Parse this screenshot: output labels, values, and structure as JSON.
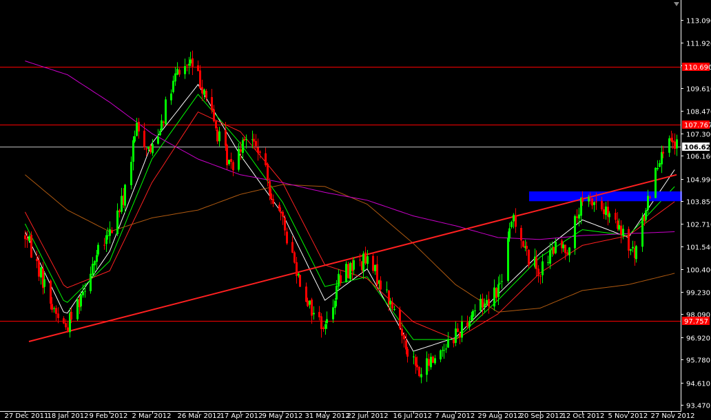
{
  "chart_data": {
    "type": "candlestick",
    "y_ticks": [
      "113.090",
      "111.920",
      "110.780",
      "109.610",
      "108.470",
      "107.300",
      "106.160",
      "104.990",
      "103.850",
      "102.710",
      "101.540",
      "100.400",
      "99.230",
      "98.090",
      "96.920",
      "95.780",
      "94.610",
      "93.470"
    ],
    "x_ticks": [
      "27 Dec 2011",
      "18 Jan 2012",
      "9 Feb 2012",
      "2 Mar 2012",
      "26 Mar 2012",
      "17 Apr 2012",
      "9 May 2012",
      "31 May 2012",
      "22 Jun 2012",
      "16 Jul 2012",
      "7 Aug 2012",
      "29 Aug 2012",
      "20 Sep 2012",
      "12 Oct 2012",
      "5 Nov 2012",
      "27 Nov 2012"
    ],
    "ylim": [
      93.2,
      113.8
    ],
    "horizontal_levels": [
      {
        "value": 110.69,
        "label": "110.690",
        "color": "#ff0000"
      },
      {
        "value": 107.767,
        "label": "107.767",
        "color": "#ff0000"
      },
      {
        "value": 97.757,
        "label": "97.757",
        "color": "#ff0000"
      }
    ],
    "current_price": {
      "value": 106.624,
      "label": "106.624",
      "color": "#c0c0c0"
    },
    "trendline": {
      "from": {
        "x": "29 Dec 2011",
        "y": 96.7
      },
      "to": {
        "x": "30 Nov 2012",
        "y": 105.2
      },
      "color": "#ff2020"
    },
    "zone": {
      "from": "20 Sep 2012",
      "to": "30 Nov 2012",
      "y_low": 103.85,
      "y_high": 104.35,
      "color": "#0000ff"
    },
    "anchors": [
      [
        "27 Dec 2011",
        102.1
      ],
      [
        "3 Jan 2012",
        100.4
      ],
      [
        "10 Jan 2012",
        98.5
      ],
      [
        "17 Jan 2012",
        97.4
      ],
      [
        "24 Jan 2012",
        98.9
      ],
      [
        "31 Jan 2012",
        100.7
      ],
      [
        "9 Feb 2012",
        102.2
      ],
      [
        "16 Feb 2012",
        104.0
      ],
      [
        "23 Feb 2012",
        107.6
      ],
      [
        "1 Mar 2012",
        106.4
      ],
      [
        "8 Mar 2012",
        108.3
      ],
      [
        "15 Mar 2012",
        110.4
      ],
      [
        "22 Mar 2012",
        110.9
      ],
      [
        "29 Mar 2012",
        109.6
      ],
      [
        "5 Apr 2012",
        107.2
      ],
      [
        "12 Apr 2012",
        105.6
      ],
      [
        "19 Apr 2012",
        107.3
      ],
      [
        "26 Apr 2012",
        106.5
      ],
      [
        "3 May 2012",
        104.3
      ],
      [
        "10 May 2012",
        102.4
      ],
      [
        "17 May 2012",
        100.1
      ],
      [
        "24 May 2012",
        98.3
      ],
      [
        "31 May 2012",
        97.4
      ],
      [
        "7 Jun 2012",
        99.8
      ],
      [
        "14 Jun 2012",
        100.6
      ],
      [
        "21 Jun 2012",
        100.8
      ],
      [
        "28 Jun 2012",
        99.9
      ],
      [
        "5 Jul 2012",
        98.4
      ],
      [
        "12 Jul 2012",
        96.6
      ],
      [
        "19 Jul 2012",
        95.0
      ],
      [
        "26 Jul 2012",
        95.8
      ],
      [
        "2 Aug 2012",
        96.6
      ],
      [
        "9 Aug 2012",
        97.3
      ],
      [
        "16 Aug 2012",
        98.3
      ],
      [
        "23 Aug 2012",
        98.8
      ],
      [
        "30 Aug 2012",
        99.6
      ],
      [
        "6 Sep 2012",
        103.2
      ],
      [
        "13 Sep 2012",
        101.1
      ],
      [
        "20 Sep 2012",
        100.3
      ],
      [
        "27 Sep 2012",
        101.4
      ],
      [
        "4 Oct 2012",
        101.5
      ],
      [
        "11 Oct 2012",
        103.6
      ],
      [
        "18 Oct 2012",
        103.9
      ],
      [
        "25 Oct 2012",
        103.1
      ],
      [
        "1 Nov 2012",
        102.2
      ],
      [
        "8 Nov 2012",
        101.0
      ],
      [
        "15 Nov 2012",
        104.0
      ],
      [
        "22 Nov 2012",
        106.6
      ],
      [
        "30 Nov 2012",
        106.62
      ]
    ],
    "overlays": [
      {
        "color": "#ffffff",
        "points": [
          [
            "27 Dec 2011",
            102.3
          ],
          [
            "17 Jan 2012",
            98.0
          ],
          [
            "9 Feb 2012",
            101.3
          ],
          [
            "2 Mar 2012",
            106.8
          ],
          [
            "26 Mar 2012",
            109.8
          ],
          [
            "17 Apr 2012",
            106.2
          ],
          [
            "9 May 2012",
            103.2
          ],
          [
            "31 May 2012",
            98.8
          ],
          [
            "22 Jun 2012",
            100.4
          ],
          [
            "16 Jul 2012",
            96.2
          ],
          [
            "7 Aug 2012",
            96.9
          ],
          [
            "29 Aug 2012",
            99.1
          ],
          [
            "20 Sep 2012",
            101.2
          ],
          [
            "12 Oct 2012",
            102.9
          ],
          [
            "5 Nov 2012",
            102.0
          ],
          [
            "30 Nov 2012",
            105.6
          ]
        ]
      },
      {
        "color": "#00ff00",
        "points": [
          [
            "27 Dec 2011",
            102.7
          ],
          [
            "17 Jan 2012",
            98.6
          ],
          [
            "9 Feb 2012",
            100.8
          ],
          [
            "2 Mar 2012",
            106.0
          ],
          [
            "26 Mar 2012",
            109.3
          ],
          [
            "17 Apr 2012",
            106.8
          ],
          [
            "9 May 2012",
            103.8
          ],
          [
            "31 May 2012",
            99.5
          ],
          [
            "22 Jun 2012",
            100.0
          ],
          [
            "16 Jul 2012",
            96.8
          ],
          [
            "7 Aug 2012",
            96.8
          ],
          [
            "29 Aug 2012",
            98.8
          ],
          [
            "20 Sep 2012",
            101.0
          ],
          [
            "12 Oct 2012",
            102.4
          ],
          [
            "5 Nov 2012",
            102.1
          ],
          [
            "30 Nov 2012",
            104.7
          ]
        ]
      },
      {
        "color": "#ff2020",
        "points": [
          [
            "27 Dec 2011",
            103.3
          ],
          [
            "17 Jan 2012",
            99.4
          ],
          [
            "9 Feb 2012",
            100.3
          ],
          [
            "2 Mar 2012",
            104.8
          ],
          [
            "26 Mar 2012",
            108.4
          ],
          [
            "17 Apr 2012",
            107.4
          ],
          [
            "9 May 2012",
            104.8
          ],
          [
            "31 May 2012",
            100.6
          ],
          [
            "22 Jun 2012",
            99.9
          ],
          [
            "16 Jul 2012",
            97.7
          ],
          [
            "7 Aug 2012",
            96.8
          ],
          [
            "29 Aug 2012",
            98.1
          ],
          [
            "20 Sep 2012",
            100.2
          ],
          [
            "12 Oct 2012",
            101.6
          ],
          [
            "5 Nov 2012",
            102.1
          ],
          [
            "30 Nov 2012",
            103.9
          ]
        ]
      },
      {
        "color": "#b05a10",
        "points": [
          [
            "27 Dec 2011",
            105.2
          ],
          [
            "18 Jan 2012",
            103.4
          ],
          [
            "9 Feb 2012",
            102.3
          ],
          [
            "2 Mar 2012",
            103.0
          ],
          [
            "26 Mar 2012",
            103.4
          ],
          [
            "17 Apr 2012",
            104.2
          ],
          [
            "9 May 2012",
            104.7
          ],
          [
            "31 May 2012",
            104.6
          ],
          [
            "22 Jun 2012",
            103.7
          ],
          [
            "16 Jul 2012",
            101.7
          ],
          [
            "7 Aug 2012",
            99.6
          ],
          [
            "29 Aug 2012",
            98.2
          ],
          [
            "20 Sep 2012",
            98.4
          ],
          [
            "12 Oct 2012",
            99.3
          ],
          [
            "5 Nov 2012",
            99.6
          ],
          [
            "30 Nov 2012",
            100.2
          ]
        ]
      },
      {
        "color": "#cc00cc",
        "points": [
          [
            "27 Dec 2011",
            111.0
          ],
          [
            "18 Jan 2012",
            110.3
          ],
          [
            "9 Feb 2012",
            108.9
          ],
          [
            "2 Mar 2012",
            107.3
          ],
          [
            "26 Mar 2012",
            106.0
          ],
          [
            "17 Apr 2012",
            105.2
          ],
          [
            "9 May 2012",
            104.8
          ],
          [
            "31 May 2012",
            104.3
          ],
          [
            "22 Jun 2012",
            103.9
          ],
          [
            "16 Jul 2012",
            103.1
          ],
          [
            "7 Aug 2012",
            102.6
          ],
          [
            "29 Aug 2012",
            102.0
          ],
          [
            "20 Sep 2012",
            101.9
          ],
          [
            "12 Oct 2012",
            102.1
          ],
          [
            "5 Nov 2012",
            102.2
          ],
          [
            "30 Nov 2012",
            102.3
          ]
        ]
      }
    ],
    "colors": {
      "background": "#000000",
      "bull": "#00ff00",
      "bear": "#ff0000",
      "axis_text": "#ffffff",
      "axis_line": "#ffffff"
    }
  }
}
